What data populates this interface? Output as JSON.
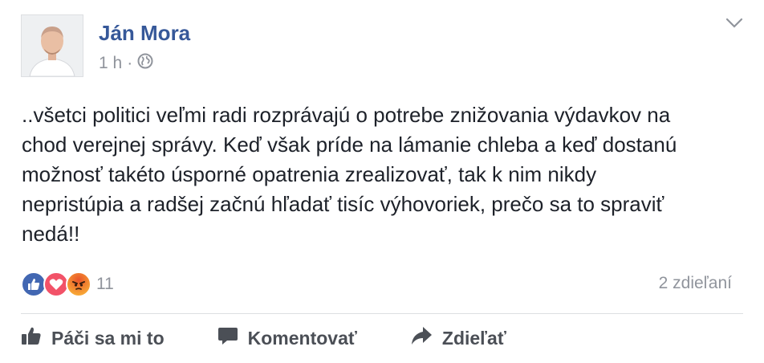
{
  "author": {
    "name": "Ján Mora"
  },
  "meta": {
    "time": "1 h",
    "separator": "·",
    "privacy_icon": "globe-icon"
  },
  "post": {
    "text": "..všetci politici veľmi radi rozprávajú o potrebe znižovania výdavkov na\nchod verejnej správy. Keď však príde na lámanie chleba a keď dostanú\nmožnosť takéto úsporné opatrenia zrealizovať, tak k nim nikdy\nnepristúpia a radšej začnú hľadať tisíc výhovoriek, prečo sa to spraviť\nnedá!!"
  },
  "reactions": {
    "types": [
      "like-reaction-icon",
      "love-reaction-icon",
      "angry-reaction-icon"
    ],
    "count": "11",
    "shares": "2 zdieľaní"
  },
  "actions": {
    "like": "Páči sa mi to",
    "comment": "Komentovať",
    "share": "Zdieľať"
  },
  "colors": {
    "name": "#365899",
    "meta": "#90949c",
    "like_blue": "#4267b2",
    "love_red": "#f25268",
    "angry_orange": "#f7a535",
    "action_gray": "#4b4f56"
  }
}
